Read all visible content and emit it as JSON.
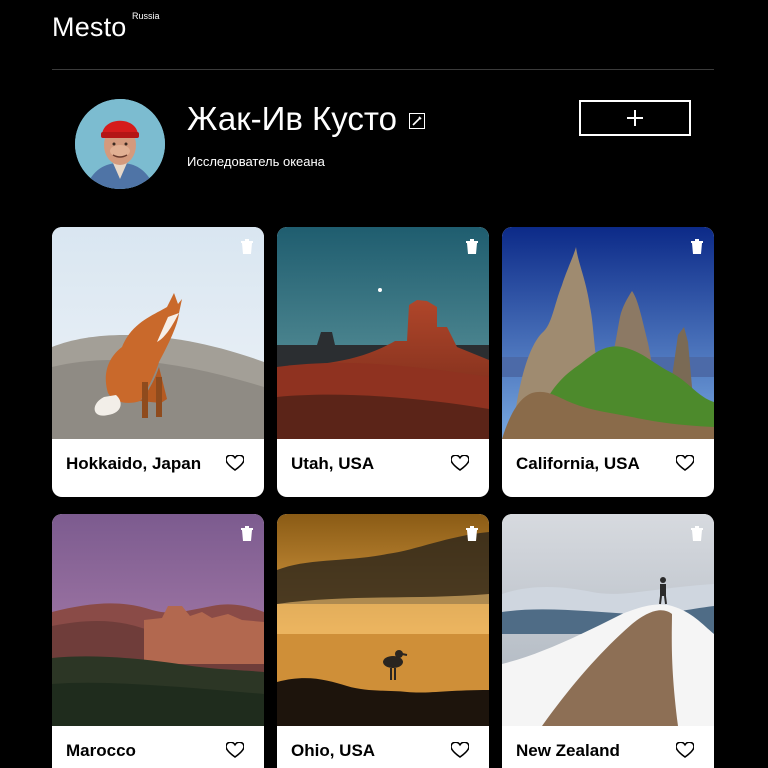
{
  "header": {
    "logo": "Mesto",
    "logo_suffix": "Russia"
  },
  "profile": {
    "name": "Жак-Ив Кусто",
    "about": "Исследователь океана",
    "edit_icon": "pencil-icon",
    "add_icon": "plus-icon"
  },
  "cards": [
    {
      "title": "Hokkaido, Japan"
    },
    {
      "title": "Utah, USA"
    },
    {
      "title": "California, USA"
    },
    {
      "title": "Marocco"
    },
    {
      "title": "Ohio, USA"
    },
    {
      "title": "New Zealand"
    }
  ],
  "colors": {
    "background": "#000000",
    "card": "#ffffff",
    "text": "#ffffff"
  }
}
